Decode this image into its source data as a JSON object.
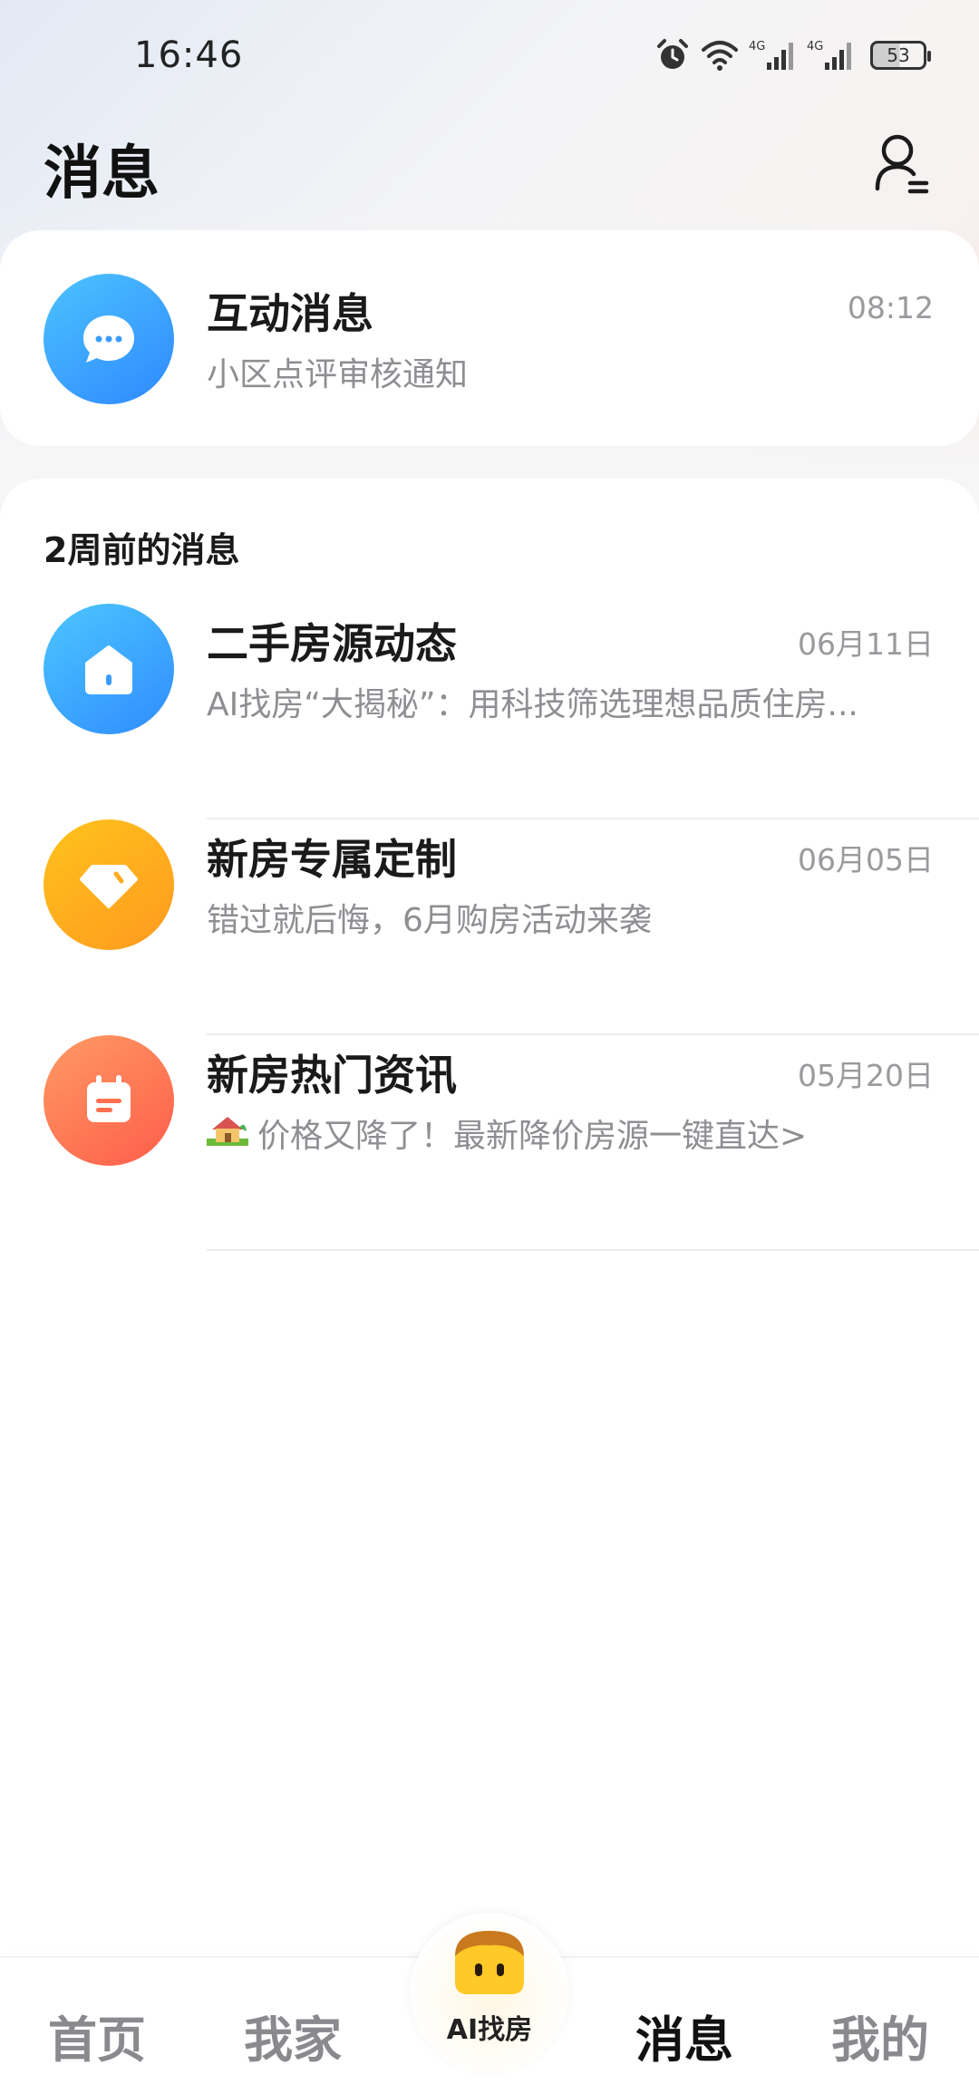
{
  "status_bar": {
    "time": "16:46",
    "network_1": "4G",
    "network_2": "4G",
    "battery": "53",
    "icons": [
      "alarm-icon",
      "wifi-icon",
      "signal-icon",
      "signal-icon",
      "battery-icon"
    ]
  },
  "header": {
    "title": "消息",
    "profile_icon": "person-settings-icon"
  },
  "interactive_message": {
    "title": "互动消息",
    "subtitle": "小区点评审核通知",
    "time": "08:12",
    "icon": "chat-bubble-icon",
    "accent": "#3a9cff"
  },
  "section": {
    "label": "2周前的消息"
  },
  "messages": [
    {
      "title": "二手房源动态",
      "subtitle": "AI找房“大揭秘”：用科技筛选理想品质住房...",
      "time": "06月11日",
      "icon": "house-icon",
      "accent": "#3a9cff"
    },
    {
      "title": "新房专属定制",
      "subtitle": "错过就后悔，6月购房活动来袭",
      "time": "06月05日",
      "icon": "diamond-icon",
      "accent": "#ffab1f"
    },
    {
      "title": "新房热门资讯",
      "subtitle": "价格又降了！最新降价房源一键直达>",
      "time": "05月20日",
      "icon": "calendar-icon",
      "accent": "#ff704f",
      "emoji": "🏡"
    }
  ],
  "bottom_nav": {
    "items": [
      {
        "label": "首页",
        "active": false
      },
      {
        "label": "我家",
        "active": false
      },
      {
        "label": "AI找房",
        "active": false
      },
      {
        "label": "消息",
        "active": true
      },
      {
        "label": "我的",
        "active": false
      }
    ],
    "center_icon": "ai-mascot-icon"
  }
}
